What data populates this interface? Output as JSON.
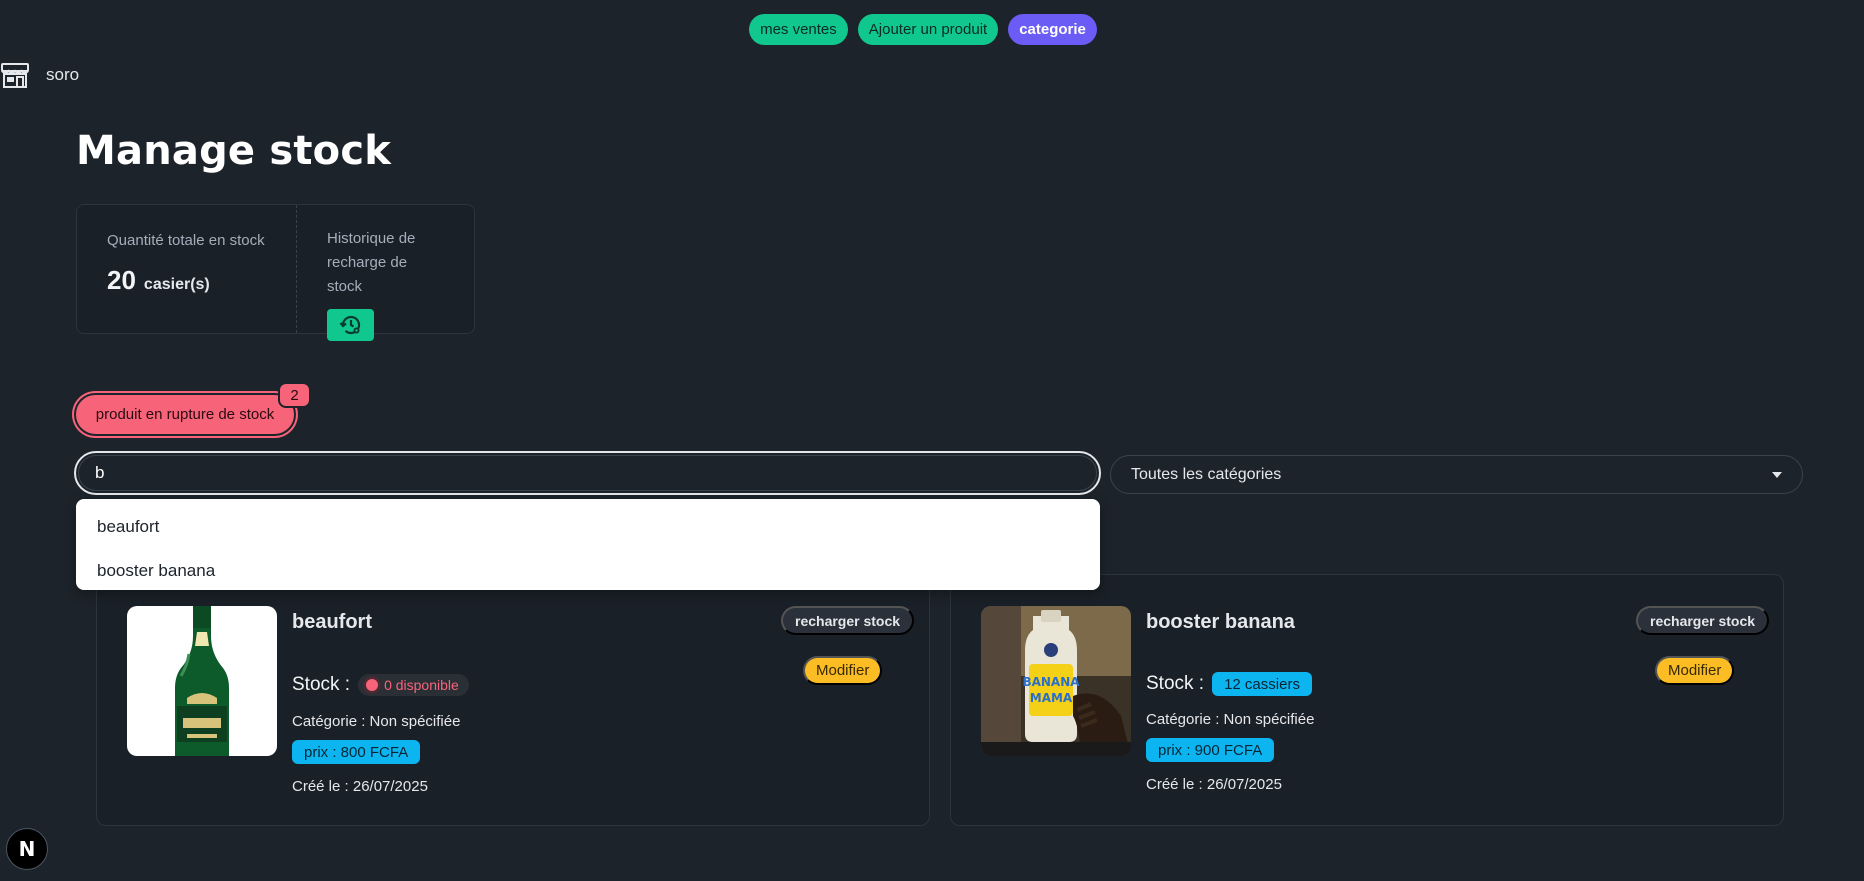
{
  "nav": {
    "items": [
      {
        "label": "mes ventes"
      },
      {
        "label": "Ajouter un produit"
      },
      {
        "label": "categorie"
      }
    ]
  },
  "brand": {
    "name": "soro",
    "icon": "store-icon"
  },
  "page": {
    "title": "Manage stock"
  },
  "stats": {
    "total_label": "Quantité totale en stock",
    "total_value": "20",
    "total_unit": "casier(s)",
    "history_label": "Historique de recharge de stock",
    "history_icon": "history-settings-icon"
  },
  "rupture": {
    "label": "produit en rupture de stock",
    "count": "2"
  },
  "search": {
    "value": "b",
    "placeholder": ""
  },
  "category_filter": {
    "selected": "Toutes les catégories"
  },
  "suggestions": [
    "beaufort",
    "booster banana"
  ],
  "products": [
    {
      "name": "beaufort",
      "stock_label": "Stock :",
      "stock_value": "0 disponible",
      "category": "Catégorie : Non spécifiée",
      "price": "prix : 800 FCFA",
      "created": "Créé le : 26/07/2025",
      "recharge_label": "recharger stock",
      "modify_label": "Modifier"
    },
    {
      "name": "booster banana",
      "stock_label": "Stock :",
      "stock_value": "12 cassiers",
      "category": "Catégorie : Non spécifiée",
      "price": "prix : 900 FCFA",
      "created": "Créé le : 26/07/2025",
      "recharge_label": "recharger stock",
      "modify_label": "Modifier"
    }
  ],
  "dev_badge": {
    "label": "N"
  },
  "colors": {
    "background": "#1d232a",
    "success": "#10c88e",
    "primary": "#6b5cf6",
    "error": "#f7647a",
    "info": "#0cb5f0",
    "warning": "#fbbd23"
  }
}
